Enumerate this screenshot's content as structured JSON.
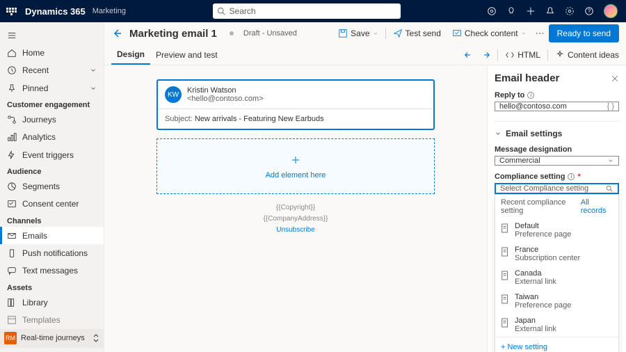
{
  "topbar": {
    "app_name": "Dynamics 365",
    "app_sub": "Marketing",
    "search_placeholder": "Search"
  },
  "leftrail": {
    "home": "Home",
    "recent": "Recent",
    "pinned": "Pinned",
    "section_engagement": "Customer engagement",
    "journeys": "Journeys",
    "analytics": "Analytics",
    "event_triggers": "Event triggers",
    "section_audience": "Audience",
    "segments": "Segments",
    "consent": "Consent center",
    "section_channels": "Channels",
    "emails": "Emails",
    "push": "Push notifications",
    "text": "Text messages",
    "section_assets": "Assets",
    "library": "Library",
    "templates": "Templates",
    "bottom_badge": "RM",
    "bottom_label": "Real-time journeys"
  },
  "header": {
    "title": "Marketing email 1",
    "status": "Draft - Unsaved",
    "save": "Save",
    "test_send": "Test send",
    "check_content": "Check content",
    "ready": "Ready to send"
  },
  "tabs": {
    "design": "Design",
    "preview": "Preview and test",
    "html": "HTML",
    "ideas": "Content ideas"
  },
  "email": {
    "from_initials": "KW",
    "from_name": "Kristin Watson",
    "from_email": "<hello@contoso.com>",
    "subject_label": "Subject:",
    "subject_value": "New arrivals - Featuring New Earbuds",
    "add_text": "Add element here",
    "footer_copyright": "{{Copyright}}",
    "footer_address": "{{CompanyAddress}}",
    "footer_unsubscribe": "Unsubscribe"
  },
  "inspector": {
    "title": "Email header",
    "reply_to_label": "Reply to",
    "reply_to_value": "hello@contoso.com",
    "section_email_settings": "Email settings",
    "designation_label": "Message designation",
    "designation_value": "Commercial",
    "compliance_label": "Compliance setting",
    "compliance_placeholder": "Select Compliance setting",
    "recent_label": "Recent compliance setting",
    "all_records": "All records",
    "options": [
      {
        "name": "Default",
        "sub": "Preference page"
      },
      {
        "name": "France",
        "sub": "Subscription center"
      },
      {
        "name": "Canada",
        "sub": "External link"
      },
      {
        "name": "Taiwan",
        "sub": "Preference page"
      },
      {
        "name": "Japan",
        "sub": "External link"
      }
    ],
    "new_setting": "+ New setting"
  }
}
